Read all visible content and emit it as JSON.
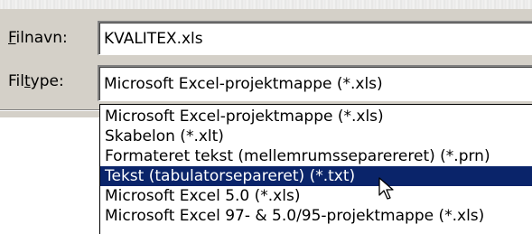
{
  "dialog": {
    "filename_label_prefix": "",
    "filename_label_mnemonic": "F",
    "filename_label_rest": "ilnavn:",
    "filename_value": "KVALITEX.xls",
    "filetype_label_prefix": "Fil",
    "filetype_label_mnemonic": "t",
    "filetype_label_rest": "ype:",
    "filetype_selected": "Microsoft Excel-projektmappe (*.xls)"
  },
  "filetype_list": {
    "items": [
      "Microsoft Excel-projektmappe (*.xls)",
      "Skabelon (*.xlt)",
      "Formateret tekst (mellemrumsseparereret) (*.prn)",
      "Tekst (tabulatorsepareret) (*.txt)",
      "Microsoft Excel 5.0 (*.xls)",
      "Microsoft Excel 97- & 5.0/95-projektmappe (*.xls)"
    ],
    "selected_index": 3
  },
  "colors": {
    "dialog_bg": "#d4d0c8",
    "selection_bg": "#0a246a",
    "selection_text": "#ffffff"
  },
  "icons": {
    "cursor": "arrow-cursor-icon"
  }
}
